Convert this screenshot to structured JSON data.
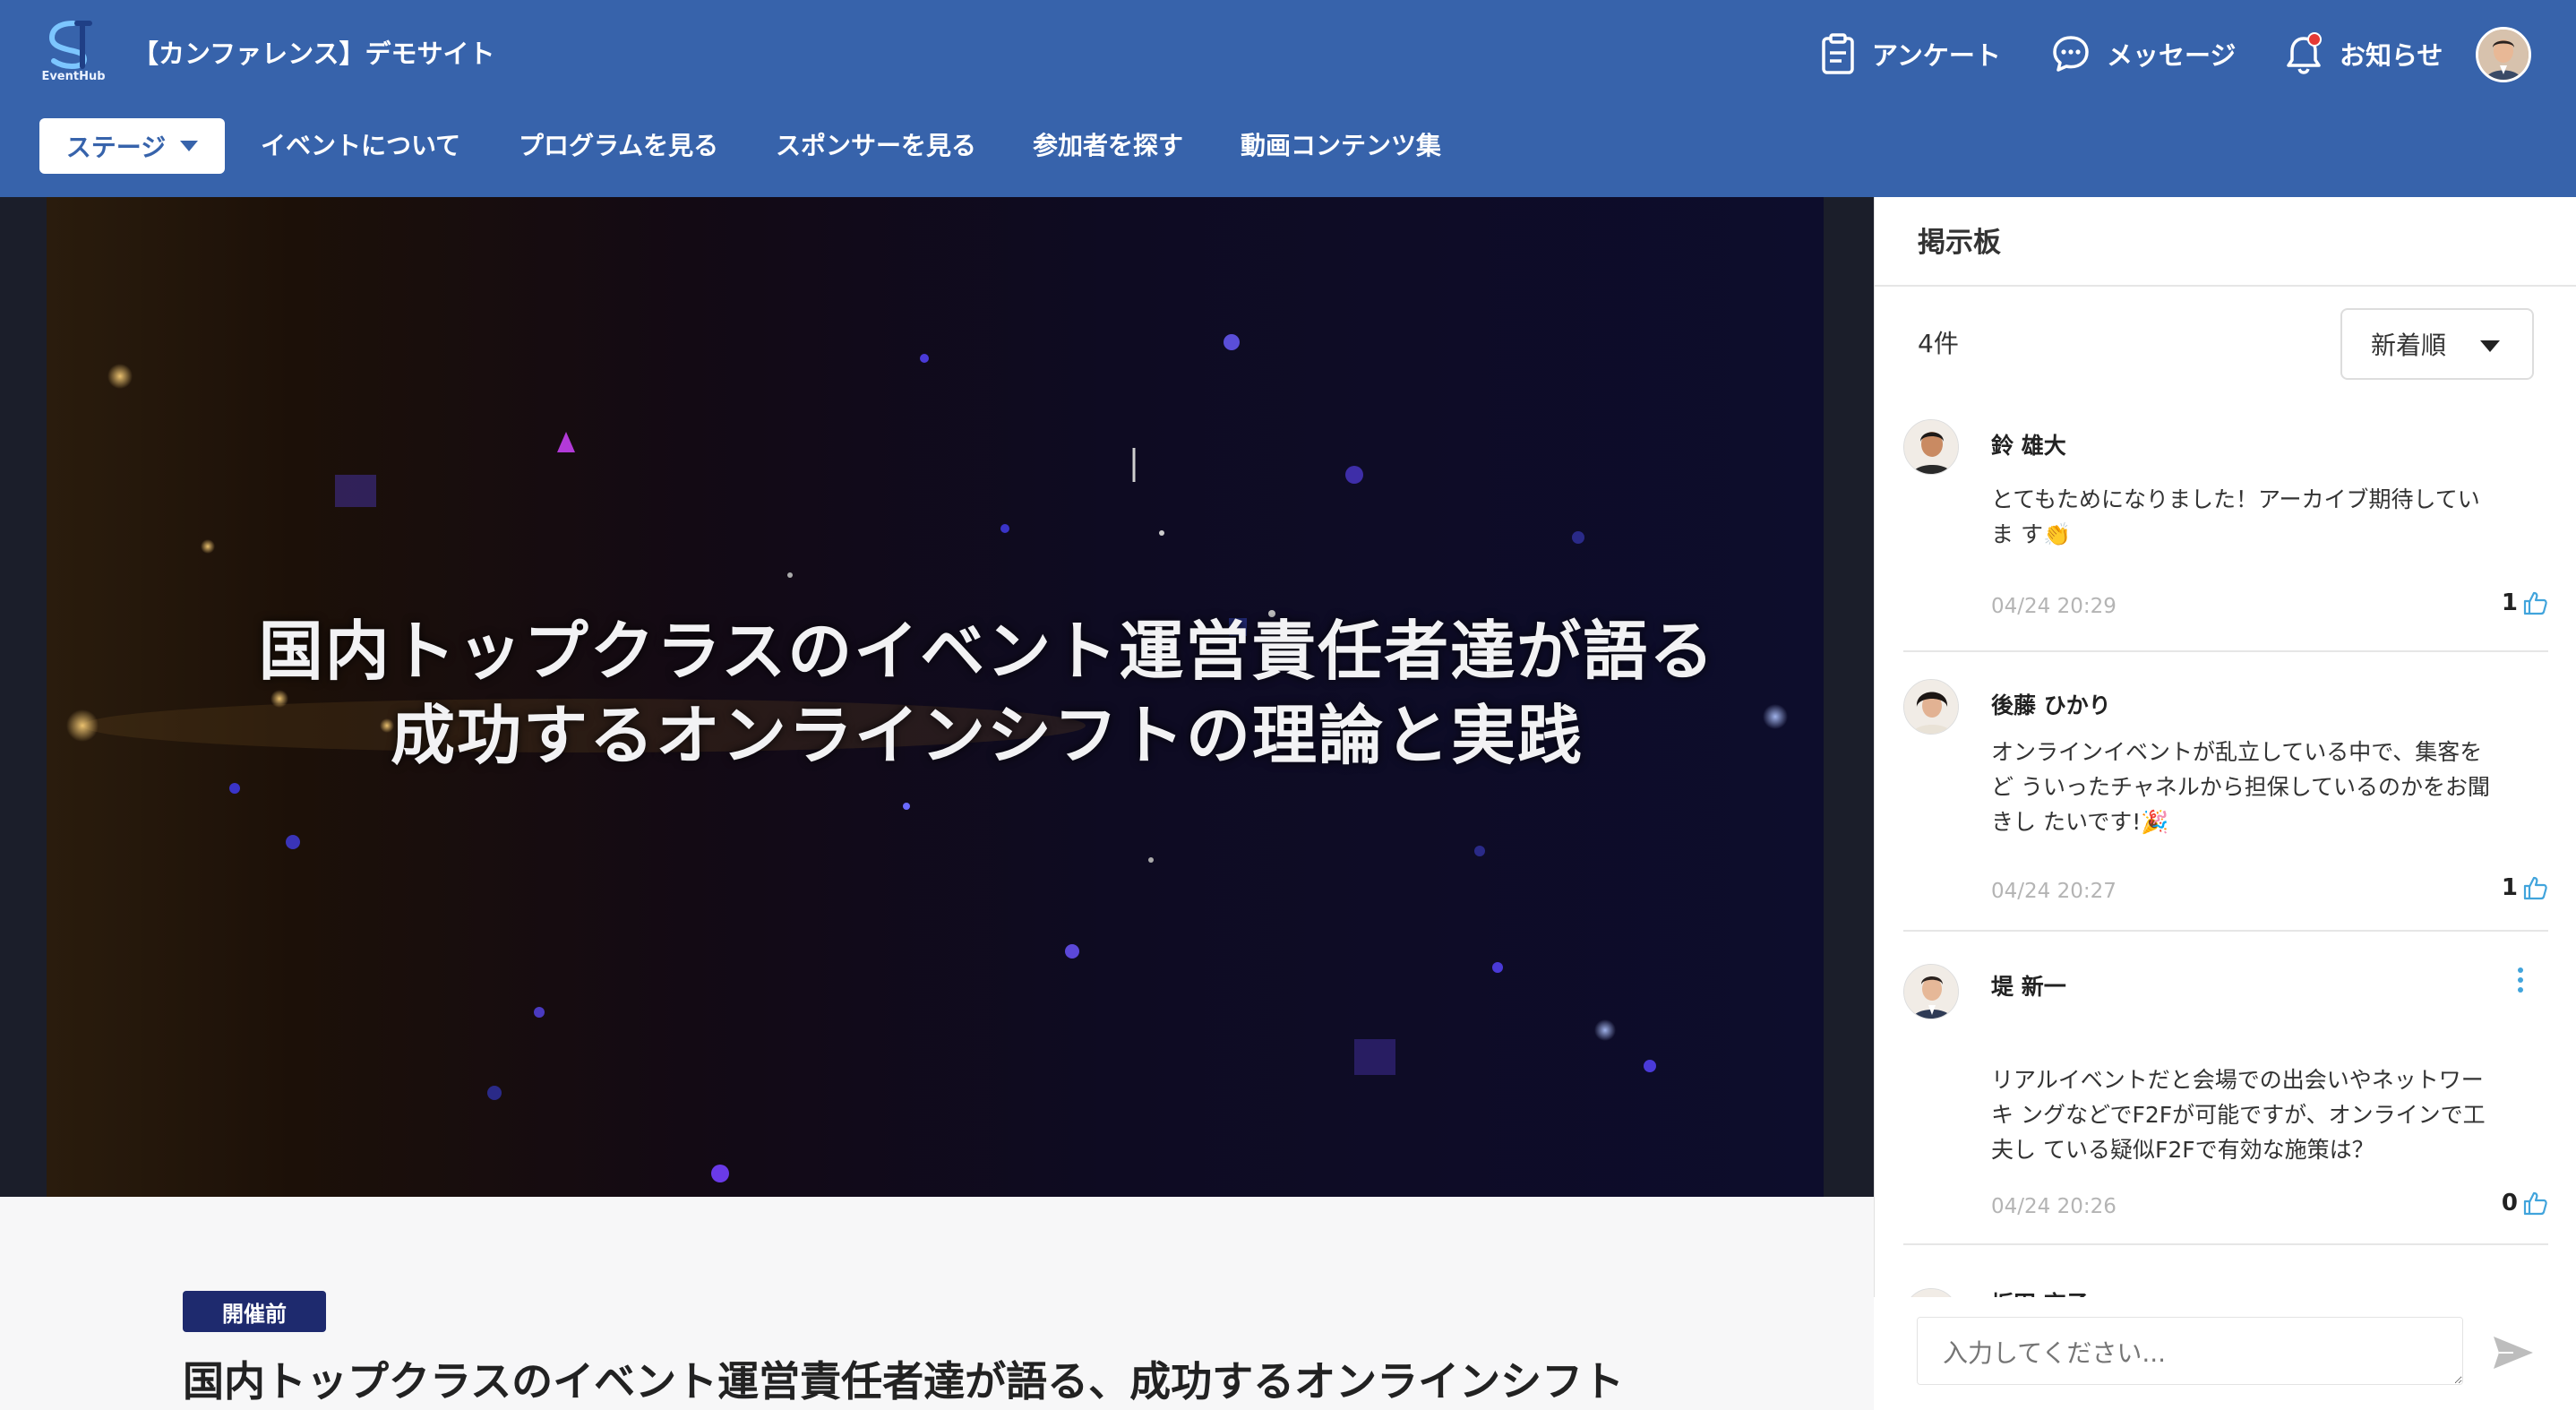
{
  "app": {
    "logo_text": "EventHub",
    "site_title": "【カンファレンス】デモサイト"
  },
  "header": {
    "survey_label": "アンケート",
    "message_label": "メッセージ",
    "notice_label": "お知らせ"
  },
  "nav": {
    "stage_label": "ステージ",
    "items": [
      "イベントについて",
      "プログラムを見る",
      "スポンサーを見る",
      "参加者を探す",
      "動画コンテンツ集"
    ]
  },
  "video": {
    "caption_line1": "国内トップクラスのイベント運営責任者達が語る",
    "caption_line2": "成功するオンラインシフトの理論と実践"
  },
  "session": {
    "status_badge": "開催前",
    "title": "国内トップクラスのイベント運営責任者達が語る、成功するオンラインシフト"
  },
  "board": {
    "title": "掲示板",
    "count": "4件",
    "sort_label": "新着順",
    "posts": [
      {
        "name": "鈴 雄大",
        "body": "とてもためになりました！アーカイブ期待していま す👏",
        "time": "04/24 20:29",
        "likes": "1"
      },
      {
        "name": "後藤 ひかり",
        "body": "オンラインイベントが乱立している中で、集客をど ういったチャネルから担保しているのかをお聞きし たいです!🎉",
        "time": "04/24 20:27",
        "likes": "1"
      },
      {
        "name": "堤 新一",
        "body": "リアルイベントだと会場での出会いやネットワーキ ングなどでF2Fが可能ですが、オンラインで工夫し ている疑似F2Fで有効な施策は？",
        "time": "04/24 20:26",
        "likes": "0"
      },
      {
        "name": "坂田 京子"
      }
    ],
    "input_placeholder": "入力してください..."
  },
  "colors": {
    "header_bg": "#3763ab",
    "badge_bg": "#1e2a6e",
    "like_blue": "#41a4dc"
  }
}
